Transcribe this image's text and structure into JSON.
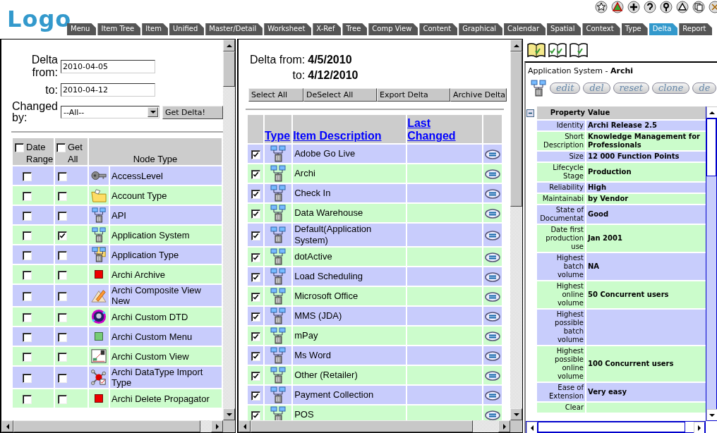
{
  "header": {
    "logo": "Logo",
    "tabs": [
      {
        "label": "Menu",
        "selected": false
      },
      {
        "label": "Item Tree",
        "selected": false
      },
      {
        "label": "Item",
        "selected": false
      },
      {
        "label": "Unified",
        "selected": false
      },
      {
        "label": "Master/Detail",
        "selected": false
      },
      {
        "label": "Worksheet",
        "selected": false
      },
      {
        "label": "X-Ref",
        "selected": false
      },
      {
        "label": "Tree",
        "selected": false
      },
      {
        "label": "Comp View",
        "selected": false
      },
      {
        "label": "Content",
        "selected": false
      },
      {
        "label": "Graphical",
        "selected": false
      },
      {
        "label": "Calendar",
        "selected": false
      },
      {
        "label": "Spatial",
        "selected": false
      },
      {
        "label": "Context",
        "selected": false
      },
      {
        "label": "Type",
        "selected": false
      },
      {
        "label": "Delta",
        "selected": true
      },
      {
        "label": "Report",
        "selected": false
      }
    ]
  },
  "filter": {
    "from_label": "Delta from:",
    "from_value": "2010-04-05",
    "to_label": "to:",
    "to_value": "2010-04-12",
    "changed_by_label": "Changed by:",
    "changed_by_value": "--All--",
    "submit": "Get Delta!"
  },
  "node_types": {
    "columns": [
      {
        "label": "Date Range",
        "checked": false
      },
      {
        "label": "Get All",
        "checked": false
      },
      {
        "label": "Node Type"
      }
    ],
    "rows": [
      {
        "kind": "key",
        "name": "AccessLevel",
        "date_range": false,
        "get_all": false
      },
      {
        "kind": "folder",
        "name": "Account Type",
        "date_range": false,
        "get_all": false
      },
      {
        "kind": "network",
        "name": "API",
        "date_range": false,
        "get_all": false
      },
      {
        "kind": "network",
        "name": "Application System",
        "date_range": false,
        "get_all": true
      },
      {
        "kind": "app-type",
        "name": "Application Type",
        "date_range": false,
        "get_all": false
      },
      {
        "kind": "red-square",
        "name": "Archi Archive",
        "date_range": false,
        "get_all": false
      },
      {
        "kind": "pencil",
        "name": "Archi Composite View New",
        "date_range": false,
        "get_all": false
      },
      {
        "kind": "globe",
        "name": "Archi Custom DTD",
        "date_range": false,
        "get_all": false
      },
      {
        "kind": "green-square",
        "name": "Archi Custom Menu",
        "date_range": false,
        "get_all": false
      },
      {
        "kind": "view",
        "name": "Archi Custom View",
        "date_range": false,
        "get_all": false
      },
      {
        "kind": "molecule",
        "name": "Archi DataType Import Type",
        "date_range": false,
        "get_all": false
      },
      {
        "kind": "red-square",
        "name": "Archi Delete Propagator",
        "date_range": false,
        "get_all": false
      }
    ]
  },
  "delta": {
    "from_label": "Delta from:",
    "from": "4/5/2010",
    "to_label": "to:",
    "to": "4/12/2010",
    "buttons": [
      "Select All",
      "DeSelect All",
      "Export Delta",
      "Archive Delta"
    ],
    "columns": [
      "Type",
      "Item Description",
      "Last Changed"
    ],
    "rows": [
      {
        "checked": true,
        "description": "Adobe Go Live"
      },
      {
        "checked": true,
        "description": "Archi"
      },
      {
        "checked": true,
        "description": "Check In"
      },
      {
        "checked": true,
        "description": "Data Warehouse"
      },
      {
        "checked": true,
        "description": "Default(Application System)"
      },
      {
        "checked": true,
        "description": "dotActive"
      },
      {
        "checked": true,
        "description": "Load Scheduling"
      },
      {
        "checked": true,
        "description": "Microsoft Office"
      },
      {
        "checked": true,
        "description": "MMS (JDA)"
      },
      {
        "checked": true,
        "description": "mPay"
      },
      {
        "checked": true,
        "description": "Ms Word"
      },
      {
        "checked": true,
        "description": "Other (Retailer)"
      },
      {
        "checked": true,
        "description": "Payment Collection"
      },
      {
        "checked": true,
        "description": "POS"
      }
    ]
  },
  "detail": {
    "views": [
      {
        "kind": "single",
        "selected": true
      },
      {
        "kind": "double",
        "selected": false
      },
      {
        "kind": "single",
        "selected": false
      }
    ],
    "title": "Application System - **Archi**",
    "actions": [
      "edit",
      "del",
      "reset",
      "clone",
      "de"
    ],
    "columns": [
      "Property",
      "Value"
    ],
    "properties": [
      {
        "name": "Identity",
        "value": "Archi Release 2.5"
      },
      {
        "name": "Short Description",
        "value": "Knowledge Management for Professionals"
      },
      {
        "name": "Size",
        "value": "12 000 Function Points"
      },
      {
        "name": "Lifecycle Stage",
        "value": "Production"
      },
      {
        "name": "Reliability",
        "value": "High"
      },
      {
        "name": "Maintainabi",
        "value": "by Vendor"
      },
      {
        "name": "State of Documentat",
        "value": "Good"
      },
      {
        "name": "Date first production use",
        "value": "Jan 2001"
      },
      {
        "name": "Highest batch volume",
        "value": "NA"
      },
      {
        "name": "Highest online volume",
        "value": "50 Concurrent users"
      },
      {
        "name": "Highest possible batch volume"
      },
      {
        "name": "Highest possible online volume",
        "value": "100 Concurrent users"
      },
      {
        "name": "Ease of Extension",
        "value": "Very easy"
      },
      {
        "name": "Clear"
      }
    ]
  }
}
